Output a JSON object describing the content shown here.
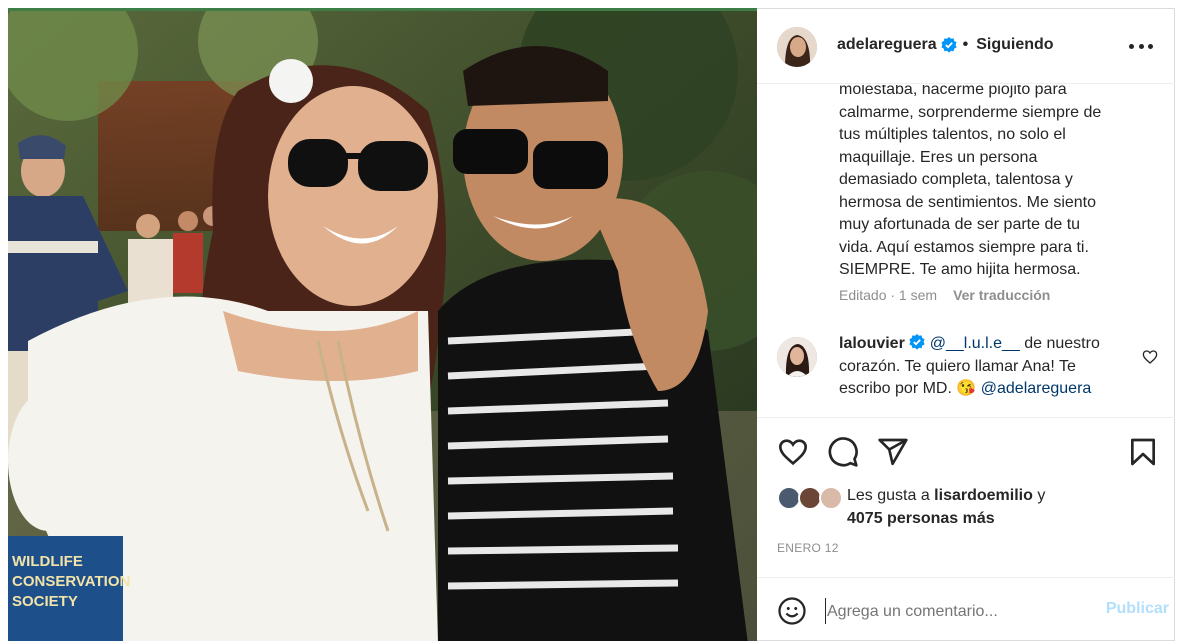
{
  "header": {
    "username": "adelareguera",
    "separator": "•",
    "following_label": "Siguiendo"
  },
  "caption": {
    "lines": [
      "molestaba, hacerme piojito para",
      "calmarme, sorprenderme siempre de",
      "tus múltiples talentos, no solo el",
      "maquillaje. Eres un persona",
      "demasiado completa, talentosa y",
      "hermosa de sentimientos. Me siento",
      "muy afortunada de ser parte de tu",
      "vida. Aquí estamos siempre para ti.",
      "SIEMPRE. Te amo hijita hermosa."
    ],
    "edited": "Editado · 1 sem",
    "translate": "Ver traducción"
  },
  "comment": {
    "username": "lalouvier",
    "mention": "@__l.u.l.e__",
    "text_1": " de nuestro",
    "text_2": "corazón. Te quiero llamar Ana! Te",
    "text_3": "escribo por MD. ",
    "emoji": "😘",
    "mention_2": "@adelareguera"
  },
  "likes": {
    "prefix": "Les gusta a ",
    "user": "lisardoemilio",
    "suffix": " y",
    "count_text": "4075 personas más"
  },
  "date": "ENERO 12",
  "add_comment": {
    "placeholder": "Agrega un comentario...",
    "publish_label": "Publicar"
  },
  "photo": {
    "sign_lines": [
      "WILDLIFE",
      "CONSERVATION",
      "SOCIETY"
    ]
  },
  "colors": {
    "verified": "#0095f6",
    "publish_disabled": "#b2dffc",
    "mention": "#00376b",
    "meta_gray": "#8e8e8e"
  }
}
